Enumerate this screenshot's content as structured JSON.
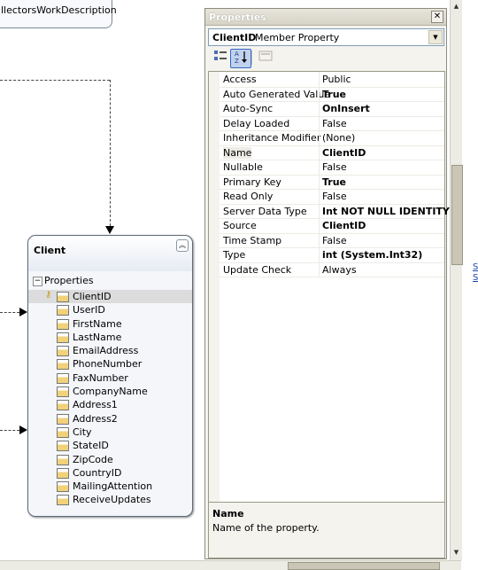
{
  "canvas": {
    "top_shape_label": "llectorsWorkDescription"
  },
  "entity": {
    "title": "Client",
    "section_label": "Properties",
    "properties": [
      {
        "name": "ClientID",
        "key": true
      },
      {
        "name": "UserID"
      },
      {
        "name": "FirstName"
      },
      {
        "name": "LastName"
      },
      {
        "name": "EmailAddress"
      },
      {
        "name": "PhoneNumber"
      },
      {
        "name": "FaxNumber"
      },
      {
        "name": "CompanyName"
      },
      {
        "name": "Address1"
      },
      {
        "name": "Address2"
      },
      {
        "name": "City"
      },
      {
        "name": "StateID"
      },
      {
        "name": "ZipCode"
      },
      {
        "name": "CountryID"
      },
      {
        "name": "MailingAttention"
      },
      {
        "name": "ReceiveUpdates"
      }
    ]
  },
  "properties_window": {
    "title": "Properties",
    "close_glyph": "✕",
    "object_name": "ClientID",
    "object_type": "Member Property",
    "rows": [
      {
        "name": "Access",
        "value": "Public",
        "bold": false
      },
      {
        "name": "Auto Generated Value",
        "value": "True",
        "bold": true
      },
      {
        "name": "Auto-Sync",
        "value": "OnInsert",
        "bold": true
      },
      {
        "name": "Delay Loaded",
        "value": "False",
        "bold": false
      },
      {
        "name": "Inheritance Modifier",
        "value": "(None)",
        "bold": false
      },
      {
        "name": "Name",
        "value": "ClientID",
        "bold": true
      },
      {
        "name": "Nullable",
        "value": "False",
        "bold": false
      },
      {
        "name": "Primary Key",
        "value": "True",
        "bold": true
      },
      {
        "name": "Read Only",
        "value": "False",
        "bold": false
      },
      {
        "name": "Server Data Type",
        "value": "Int NOT NULL IDENTITY",
        "bold": true
      },
      {
        "name": "Source",
        "value": "ClientID",
        "bold": true
      },
      {
        "name": "Time Stamp",
        "value": "False",
        "bold": false
      },
      {
        "name": "Type",
        "value": "int (System.Int32)",
        "bold": true
      },
      {
        "name": "Update Check",
        "value": "Always",
        "bold": false
      }
    ],
    "description": {
      "title": "Name",
      "text": "Name of the property."
    }
  },
  "right_clip_letters": [
    "S",
    "S"
  ]
}
